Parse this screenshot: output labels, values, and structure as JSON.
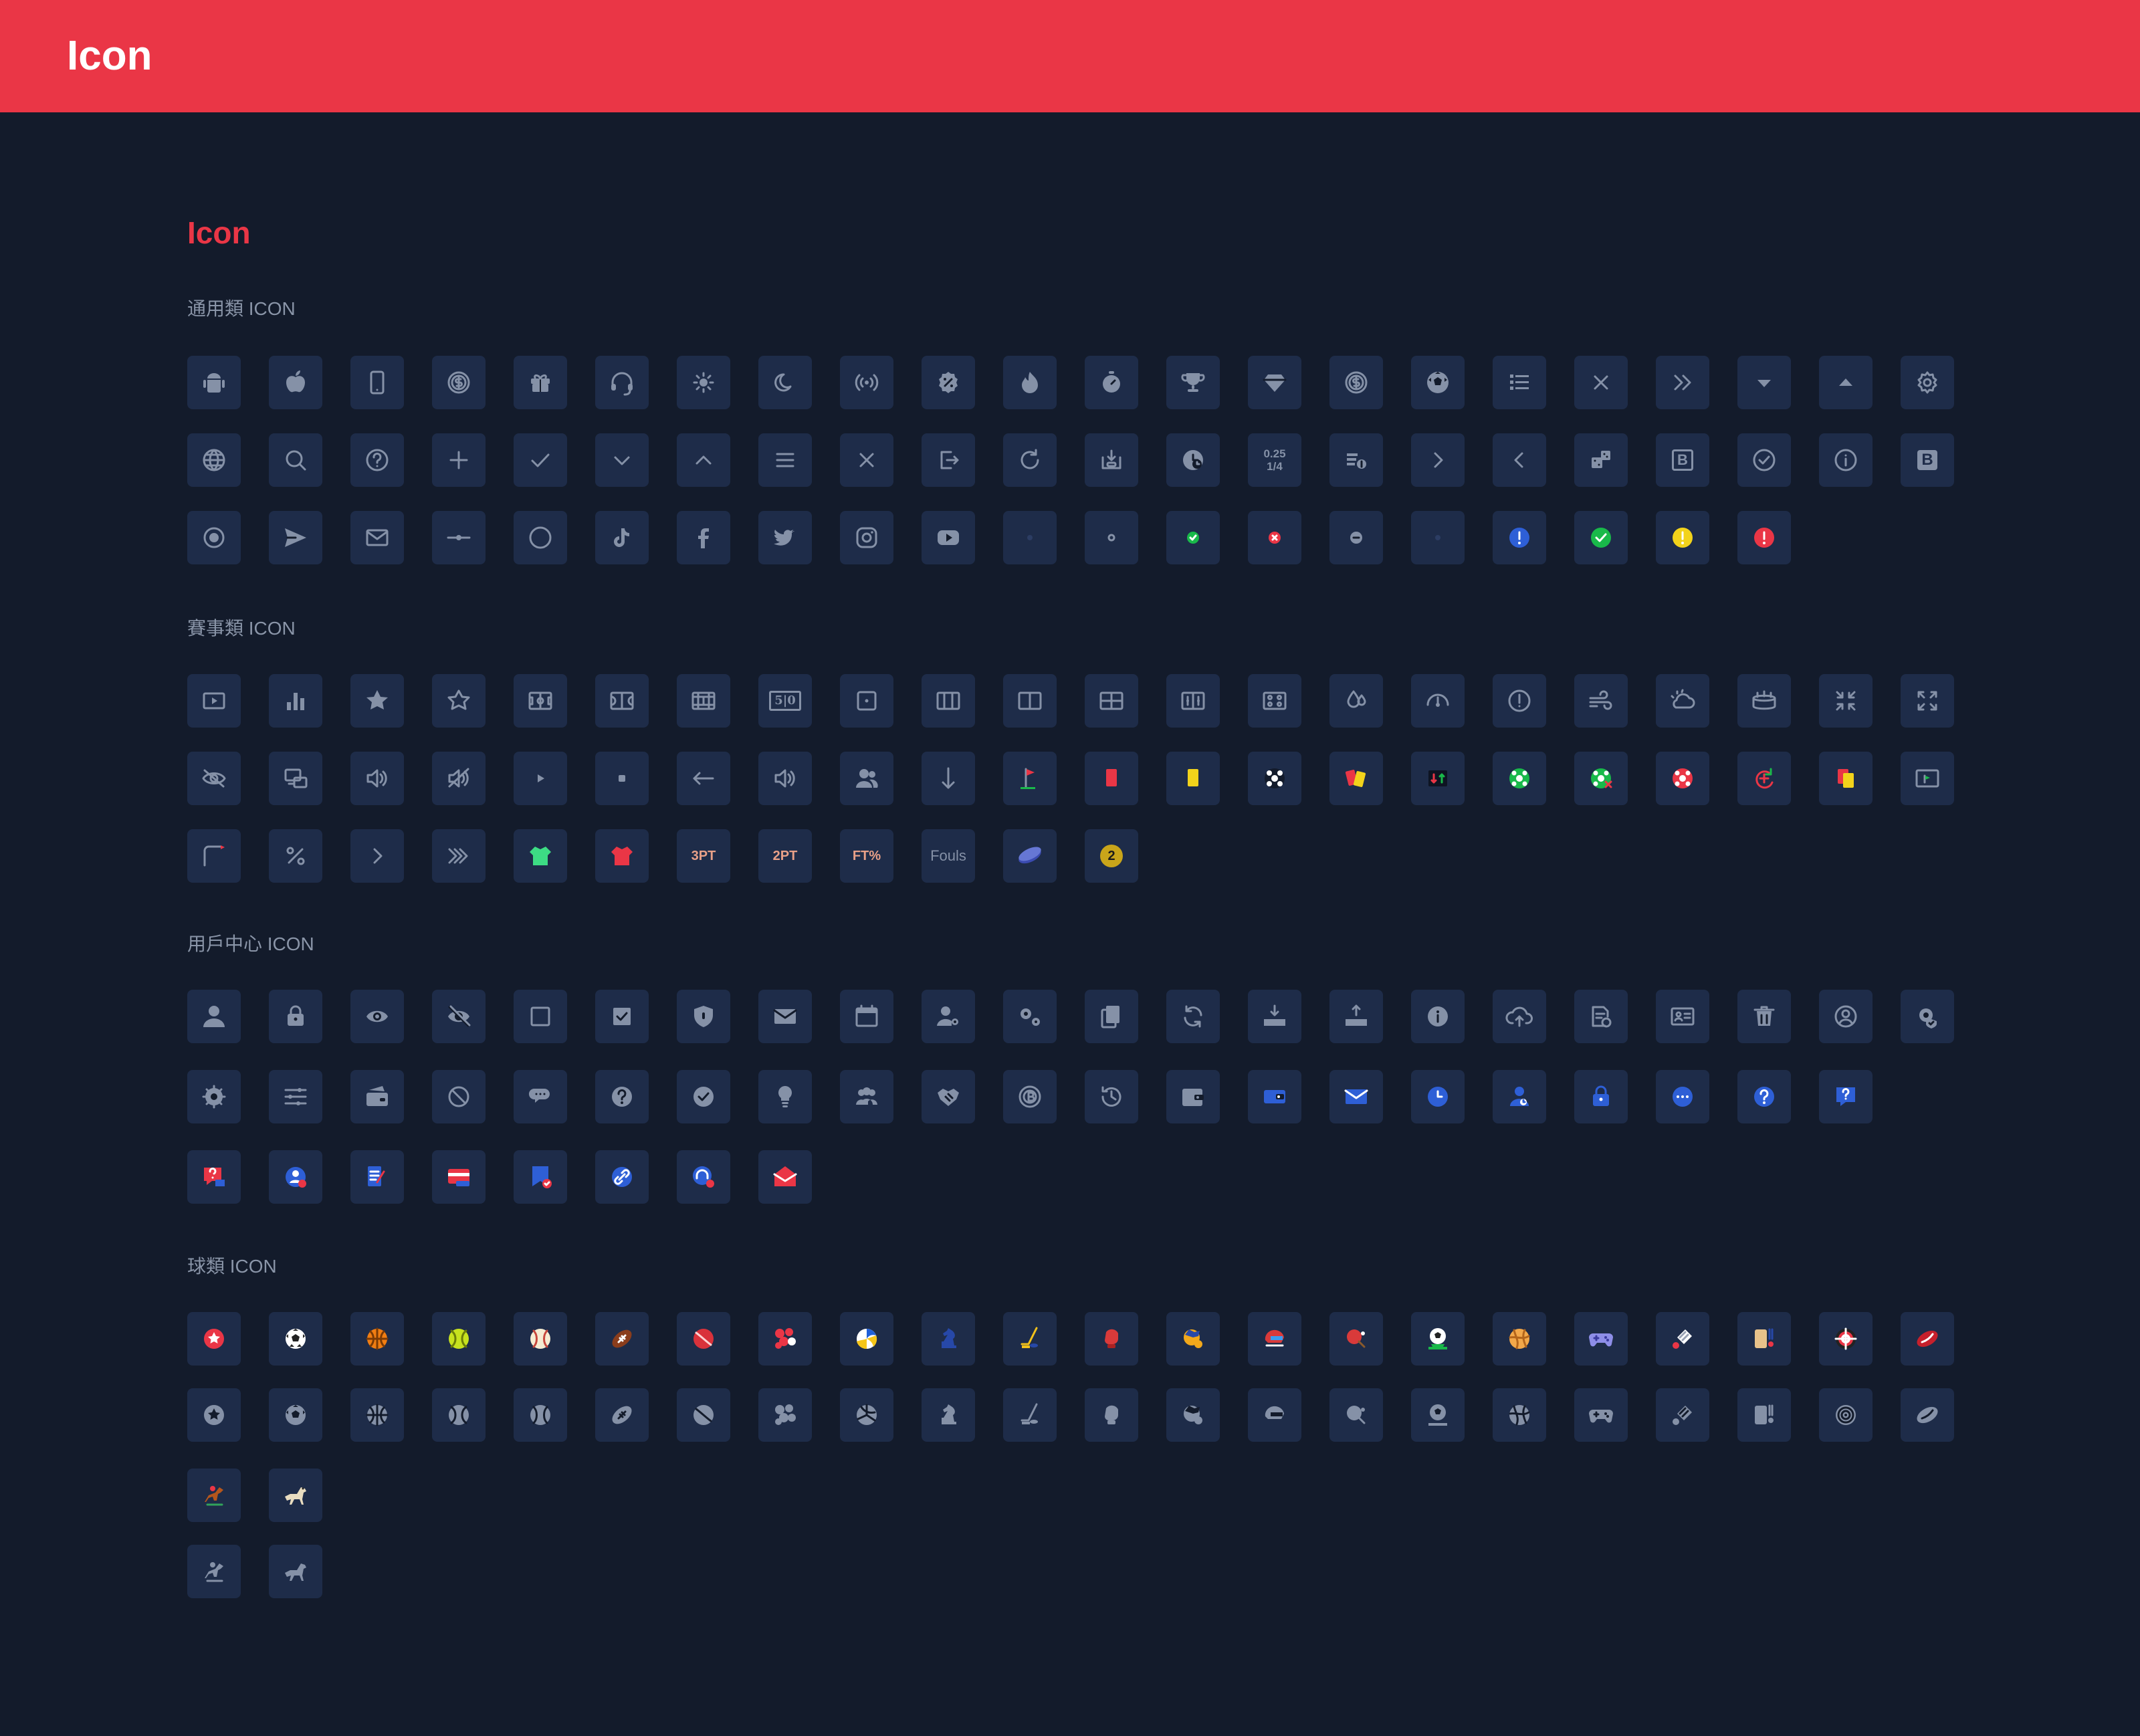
{
  "header": {
    "title": "Icon"
  },
  "page": {
    "title": "Icon"
  },
  "sections": [
    {
      "title": "通用類 ICON",
      "rows": [
        [
          "android-icon",
          "apple-icon",
          "mobile-icon",
          "dollar-coin-icon",
          "gift-icon",
          "headset-icon",
          "sun-icon",
          "moon-icon",
          "broadcast-icon",
          "discount-icon",
          "fire-icon",
          "timer-icon",
          "trophy-icon",
          "diamond-icon",
          "dollar-coin-icon",
          "soccer-ball-icon",
          "list-icon",
          "close-icon",
          "double-chevron-right-icon",
          "caret-down-icon",
          "caret-up-icon",
          "settings-icon"
        ],
        [
          "globe-icon",
          "search-icon",
          "help-circle-icon",
          "plus-icon",
          "check-icon",
          "chevron-down-icon",
          "chevron-up-icon",
          "menu-icon",
          "close-icon",
          "logout-icon",
          "refresh-icon",
          "deposit-icon",
          "stats-clock-icon",
          "odds-format-icon",
          "coin-stack-icon",
          "chevron-right-icon",
          "chevron-left-icon",
          "dice-icon",
          "bold-b-icon",
          "check-circle-icon",
          "info-circle-icon",
          "bold-b-filled-icon"
        ],
        [
          "radio-selected-icon",
          "send-icon",
          "mail-icon",
          "slider-icon",
          "circle-icon",
          "tiktok-icon",
          "facebook-icon",
          "twitter-icon",
          "instagram-icon",
          "youtube-icon",
          "dot-dark-icon",
          "dot-outline-icon",
          "status-success-small-icon",
          "status-error-small-icon",
          "status-minus-small-icon",
          "dot-dark-icon",
          "info-blue-icon",
          "success-green-icon",
          "warning-yellow-icon",
          "error-red-icon"
        ]
      ]
    },
    {
      "title": "賽事類 ICON",
      "rows": [
        [
          "live-video-icon",
          "bar-chart-icon",
          "star-filled-icon",
          "star-outline-icon",
          "soccer-pitch-icon",
          "basketball-court-icon",
          "tennis-court-icon",
          "scoreboard-icon",
          "dice-one-icon",
          "columns-three-icon",
          "columns-two-icon",
          "grid-four-icon",
          "field-markers-icon",
          "match-lineup-icon",
          "humidity-icon",
          "gauge-icon",
          "alert-circle-icon",
          "wind-icon",
          "weather-cloud-sun-icon",
          "stadium-icon",
          "collapse-icon",
          "expand-icon"
        ],
        [
          "eye-off-icon",
          "screen-icon",
          "volume-icon",
          "mute-icon",
          "play-icon",
          "stop-icon",
          "arrow-left-icon",
          "speaker-icon",
          "user-group-icon",
          "arrow-down-icon",
          "corner-flag-icon",
          "red-card-icon",
          "yellow-card-icon",
          "goal-icon",
          "card-swap-icon",
          "substitution-icon",
          "soccer-ball-green-icon",
          "own-goal-icon",
          "penalty-icon",
          "var-check-icon",
          "red-yellow-card-icon",
          "screen-flag-icon"
        ],
        [
          "corner-icon",
          "percent-icon",
          "chevron-right-icon",
          "triple-chevron-icon",
          "shirt-green-icon",
          "shirt-red-icon",
          "three-pointer-icon",
          "two-pointer-icon",
          "free-throw-icon",
          "fouls-icon",
          "hockey-puck-icon",
          "period-badge-icon"
        ]
      ]
    },
    {
      "title": "用戶中心 ICON",
      "rows": [
        [
          "user-icon",
          "lock-icon",
          "eye-icon",
          "eye-slash-icon",
          "checkbox-empty-icon",
          "checkbox-checked-icon",
          "shield-icon",
          "mail-filled-icon",
          "calendar-icon",
          "user-settings-icon",
          "gears-icon",
          "copy-icon",
          "sync-icon",
          "withdraw-icon",
          "deposit-tray-icon",
          "info-filled-icon",
          "cloud-upload-icon",
          "document-clock-icon",
          "id-card-icon",
          "trash-icon",
          "account-circle-icon",
          "security-gear-icon"
        ],
        [
          "settings-filled-icon",
          "filters-icon",
          "wallet-card-icon",
          "ban-icon",
          "chat-icon",
          "help-filled-icon",
          "check-badge-icon",
          "lightbulb-icon",
          "users-icon",
          "handshake-icon",
          "bitcoin-gear-icon",
          "history-icon",
          "wallet-icon",
          "card-blue-icon",
          "mail-blue-icon",
          "clock-blue-icon",
          "user-blue-icon",
          "lock-blue-icon",
          "more-blue-icon",
          "help-blue-icon",
          "help-square-blue-icon"
        ],
        [
          "feedback-icon",
          "user-badge-icon",
          "edit-document-icon",
          "bank-card-icon",
          "bookmark-check-icon",
          "link-icon",
          "support-help-icon",
          "mail-red-icon"
        ]
      ]
    },
    {
      "title": "球類 ICON",
      "rows": [
        [
          "favorites-color-icon",
          "soccer-color-icon",
          "basketball-color-icon",
          "tennis-color-icon",
          "baseball-color-icon",
          "american-football-color-icon",
          "cricket-color-icon",
          "snooker-color-icon",
          "volleyball-color-icon",
          "chess-color-icon",
          "ice-hockey-color-icon",
          "boxing-color-icon",
          "esports-color-icon",
          "motorsport-color-icon",
          "table-tennis-color-icon",
          "fantasy-football-color-icon",
          "handball-color-icon",
          "gaming-color-icon",
          "badminton-color-icon",
          "cricket-bat-color-icon",
          "darts-color-icon",
          "rugby-color-icon"
        ],
        [
          "favorites-icon",
          "soccer-icon",
          "basketball-icon",
          "tennis-icon",
          "baseball-icon",
          "american-football-icon",
          "cricket-icon",
          "snooker-icon",
          "volleyball-icon",
          "chess-icon",
          "ice-hockey-icon",
          "boxing-icon",
          "esports-icon",
          "motorsport-icon",
          "table-tennis-icon",
          "fantasy-football-icon",
          "handball-icon",
          "gaming-icon",
          "badminton-icon",
          "cricket-bat-icon",
          "darts-icon",
          "rugby-icon"
        ],
        [
          "horse-racing-color-icon",
          "greyhound-color-icon"
        ],
        [
          "horse-racing-icon",
          "greyhound-icon"
        ]
      ]
    }
  ],
  "tile_text": {
    "odds-format-icon": "0.25\n1/4",
    "three-pointer-icon": "3PT",
    "two-pointer-icon": "2PT",
    "free-throw-icon": "FT%",
    "fouls-icon": "Fouls",
    "period-badge-icon": "2",
    "bold-b-icon": "B",
    "bold-b-filled-icon": "B",
    "scoreboard-icon": "5|0"
  },
  "colors": {
    "header_bg": "#ea3646",
    "page_bg": "#131b2b",
    "tile_bg": "#1e2c49",
    "icon_gray": "#8591a7",
    "accent_red": "#ea3646",
    "green": "#19b94a",
    "blue": "#2e5fd6",
    "yellow": "#f2d31b"
  }
}
